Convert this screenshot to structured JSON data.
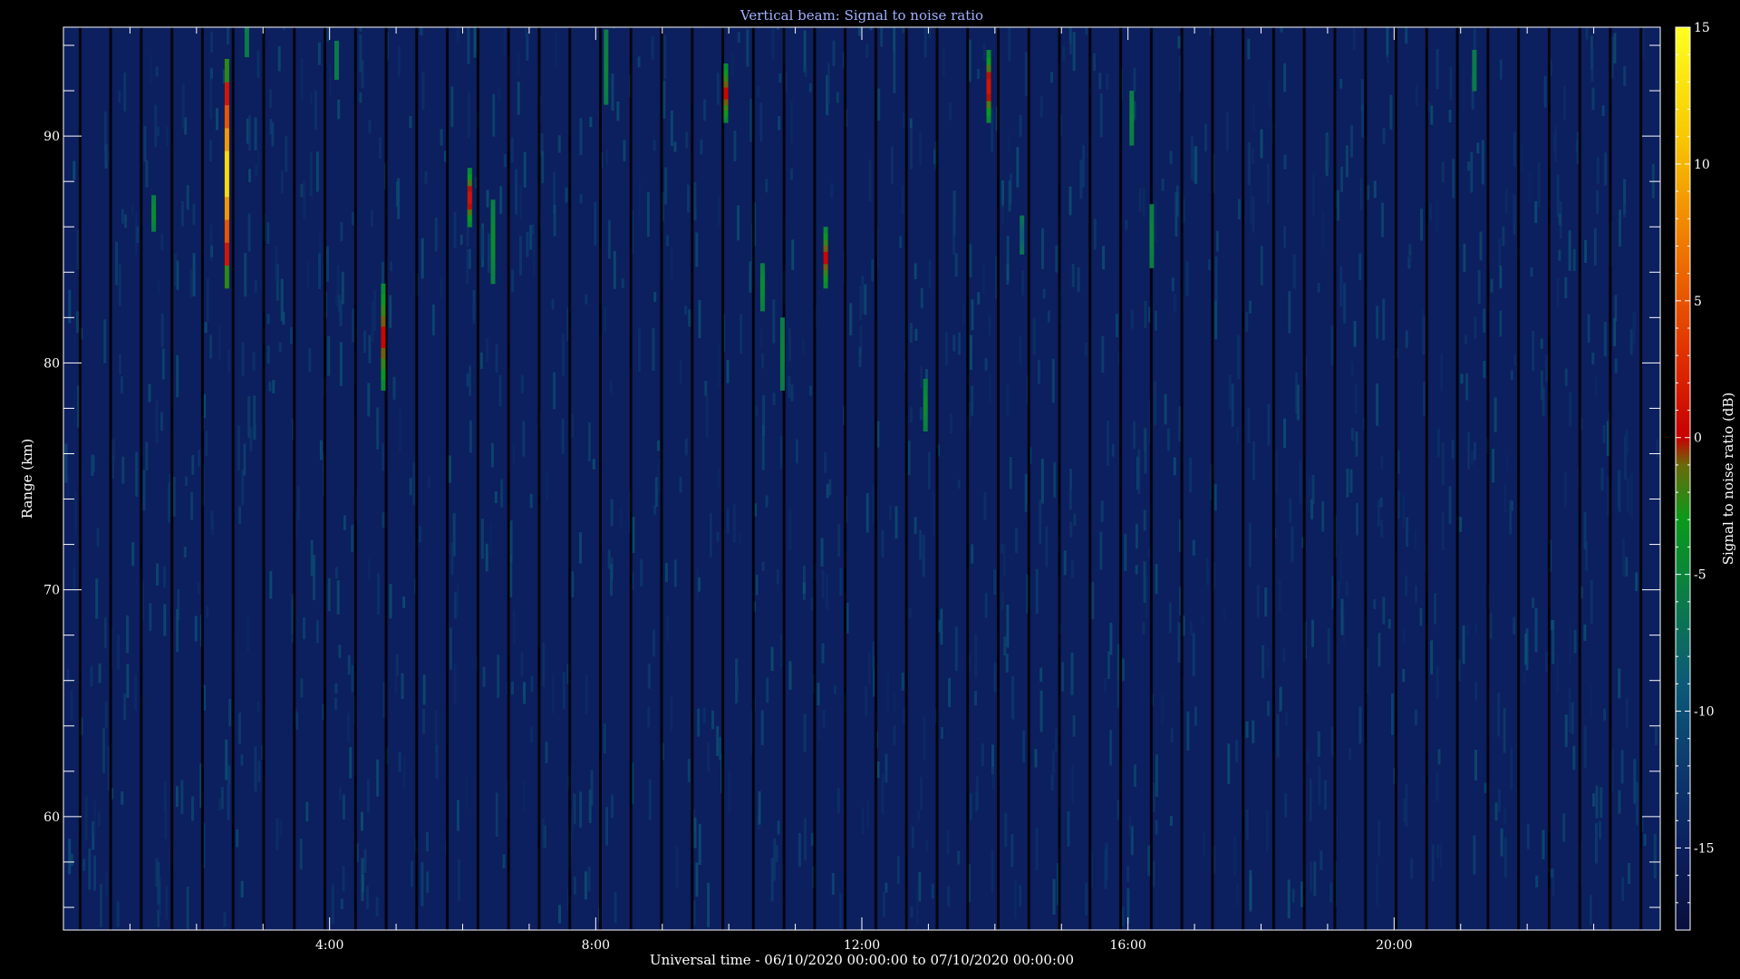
{
  "chart_data": {
    "type": "heatmap",
    "title": "Vertical beam: Signal to noise ratio",
    "xlabel": "Universal time - 06/10/2020 00:00:00 to 07/10/2020 00:00:00",
    "ylabel": "Range (km)",
    "colorbar_label": "Signal to noise ratio (dB)",
    "x_range_hours": [
      0,
      24
    ],
    "x_ticks": [
      {
        "hour": 4,
        "label": "4:00"
      },
      {
        "hour": 8,
        "label": "8:00"
      },
      {
        "hour": 12,
        "label": "12:00"
      },
      {
        "hour": 16,
        "label": "16:00"
      },
      {
        "hour": 20,
        "label": "20:00"
      }
    ],
    "y_range_km": [
      55,
      94.8
    ],
    "y_ticks": [
      {
        "km": 60,
        "label": "60"
      },
      {
        "km": 70,
        "label": "70"
      },
      {
        "km": 80,
        "label": "80"
      },
      {
        "km": 90,
        "label": "90"
      }
    ],
    "colorbar_range_db": [
      -18,
      15
    ],
    "colorbar_ticks": [
      {
        "db": 15,
        "label": "15"
      },
      {
        "db": 10,
        "label": "10"
      },
      {
        "db": 5,
        "label": "5"
      },
      {
        "db": 0,
        "label": "0"
      },
      {
        "db": -5,
        "label": "-5"
      },
      {
        "db": -10,
        "label": "-10"
      },
      {
        "db": -15,
        "label": "-15"
      }
    ],
    "colormap": [
      {
        "db": -18,
        "color": "#0a0f3c"
      },
      {
        "db": -15,
        "color": "#0c1f5e"
      },
      {
        "db": -12,
        "color": "#0d3a6e"
      },
      {
        "db": -9,
        "color": "#0c5a78"
      },
      {
        "db": -6,
        "color": "#0b7a4a"
      },
      {
        "db": -3,
        "color": "#0a9a1a"
      },
      {
        "db": -1,
        "color": "#6a6a0a"
      },
      {
        "db": 0,
        "color": "#c80000"
      },
      {
        "db": 3,
        "color": "#e03000"
      },
      {
        "db": 7,
        "color": "#f07800"
      },
      {
        "db": 11,
        "color": "#f8c800"
      },
      {
        "db": 15,
        "color": "#ffff20"
      }
    ],
    "background_level_db": -15,
    "echoes": [
      {
        "t": 1.35,
        "r0": 85.8,
        "r1": 87.4,
        "peak_db": -4
      },
      {
        "t": 2.45,
        "r0": 83.3,
        "r1": 93.4,
        "peak_db": 14
      },
      {
        "t": 2.75,
        "r0": 93.5,
        "r1": 94.8,
        "peak_db": -6
      },
      {
        "t": 4.1,
        "r0": 92.5,
        "r1": 94.2,
        "peak_db": -6
      },
      {
        "t": 4.8,
        "r0": 78.8,
        "r1": 83.5,
        "peak_db": 1
      },
      {
        "t": 6.1,
        "r0": 86.0,
        "r1": 88.6,
        "peak_db": 2
      },
      {
        "t": 6.45,
        "r0": 83.5,
        "r1": 87.2,
        "peak_db": -4
      },
      {
        "t": 8.15,
        "r0": 91.4,
        "r1": 94.7,
        "peak_db": -5
      },
      {
        "t": 9.95,
        "r0": 90.6,
        "r1": 93.2,
        "peak_db": 1
      },
      {
        "t": 10.5,
        "r0": 82.3,
        "r1": 84.4,
        "peak_db": -4
      },
      {
        "t": 10.8,
        "r0": 78.8,
        "r1": 82.0,
        "peak_db": -5
      },
      {
        "t": 11.45,
        "r0": 83.3,
        "r1": 86.0,
        "peak_db": 1
      },
      {
        "t": 12.95,
        "r0": 77.0,
        "r1": 79.3,
        "peak_db": -4
      },
      {
        "t": 13.9,
        "r0": 90.6,
        "r1": 93.8,
        "peak_db": 2
      },
      {
        "t": 14.4,
        "r0": 84.8,
        "r1": 86.5,
        "peak_db": -9
      },
      {
        "t": 16.05,
        "r0": 89.6,
        "r1": 92.0,
        "peak_db": -5
      },
      {
        "t": 16.35,
        "r0": 84.2,
        "r1": 87.0,
        "peak_db": -5
      },
      {
        "t": 21.2,
        "r0": 92.0,
        "r1": 93.8,
        "peak_db": -6
      }
    ]
  }
}
